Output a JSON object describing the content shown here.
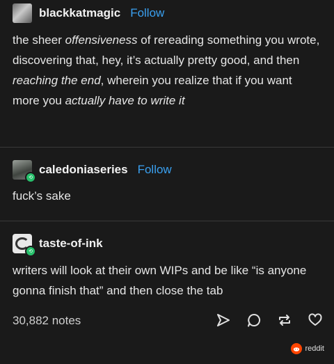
{
  "posts": [
    {
      "username": "blackkatmagic",
      "follow": "Follow",
      "text_parts": [
        {
          "t": "the sheer ",
          "i": false
        },
        {
          "t": "offensiveness",
          "i": true
        },
        {
          "t": " of rereading something you wrote, discovering that, hey, it’s actually pretty good, and then ",
          "i": false
        },
        {
          "t": "reaching the end",
          "i": true
        },
        {
          "t": ", wherein you realize that if you want more you ",
          "i": false
        },
        {
          "t": "actually have to write it",
          "i": true
        }
      ]
    },
    {
      "username": "caledoniaseries",
      "follow": "Follow",
      "text": "fuck’s sake"
    },
    {
      "username": "taste-of-ink",
      "text": "writers will look at their own WIPs and be like “is anyone gonna finish that” and then close the tab"
    }
  ],
  "footer": {
    "notes": "30,882 notes",
    "icons": [
      "share-icon",
      "reply-icon",
      "reblog-icon",
      "like-icon"
    ]
  },
  "watermark": {
    "label": "reddit",
    "color": "#ff4500"
  },
  "colors": {
    "background": "#1a1a1a",
    "follow": "#3aa0f0",
    "reblog_badge": "#27c06b"
  }
}
